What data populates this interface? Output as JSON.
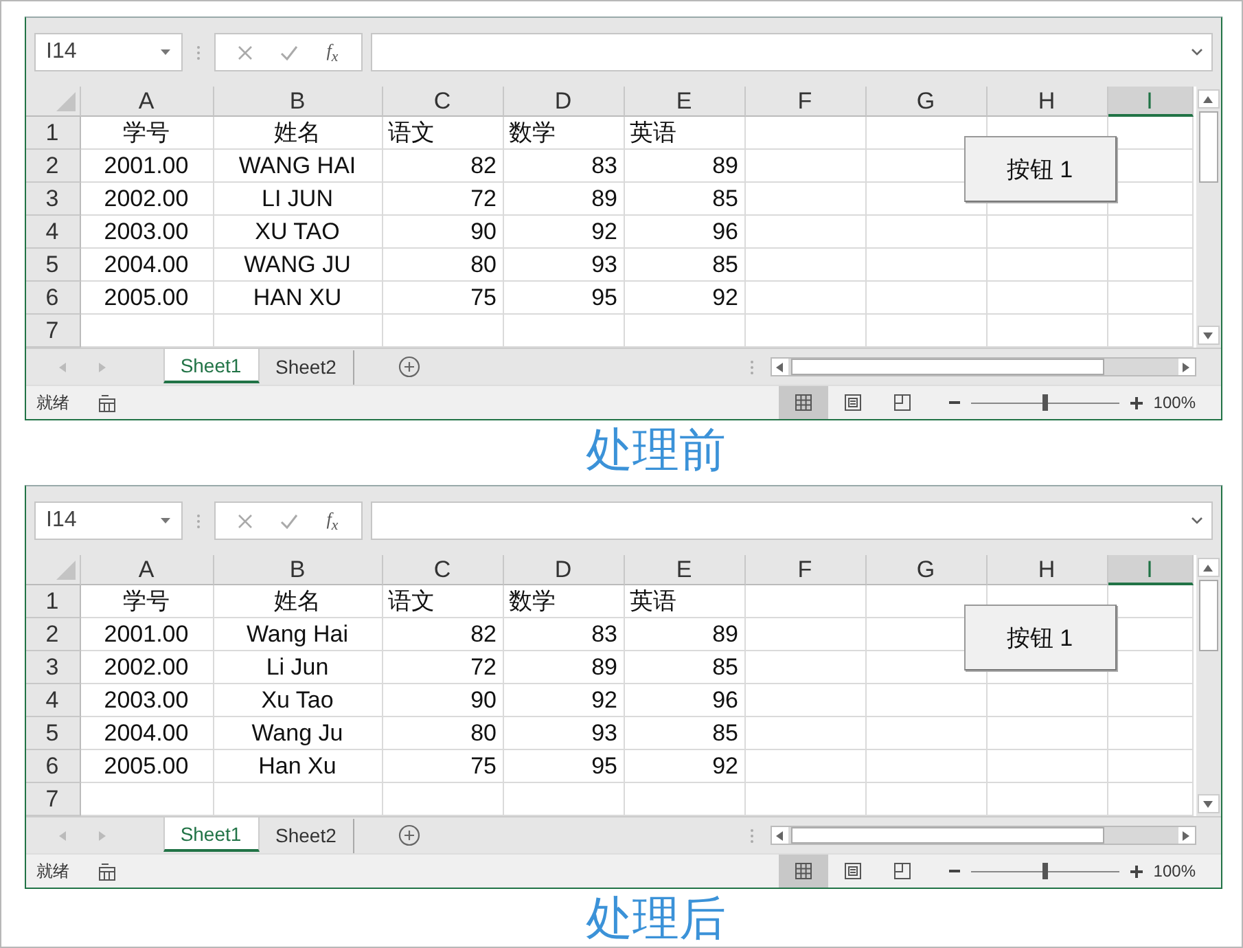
{
  "panels": [
    {
      "name_box": "I14",
      "fx_label": "f$_{x}$",
      "columns": [
        {
          "label": "A",
          "selected": false
        },
        {
          "label": "B",
          "selected": false
        },
        {
          "label": "C",
          "selected": false
        },
        {
          "label": "D",
          "selected": false
        },
        {
          "label": "E",
          "selected": false
        },
        {
          "label": "F",
          "selected": false
        },
        {
          "label": "G",
          "selected": false
        },
        {
          "label": "H",
          "selected": false
        },
        {
          "label": "I",
          "selected": true
        }
      ],
      "rows": [
        {
          "number": "1",
          "kind": "header",
          "cells": [
            "学号",
            "姓名",
            "语文",
            "数学",
            "英语"
          ]
        },
        {
          "number": "2",
          "kind": "record",
          "cells": [
            "2001.00",
            "WANG HAI",
            "82",
            "83",
            "89"
          ]
        },
        {
          "number": "3",
          "kind": "record",
          "cells": [
            "2002.00",
            "LI JUN",
            "72",
            "89",
            "85"
          ]
        },
        {
          "number": "4",
          "kind": "record",
          "cells": [
            "2003.00",
            "XU TAO",
            "90",
            "92",
            "96"
          ]
        },
        {
          "number": "5",
          "kind": "record",
          "cells": [
            "2004.00",
            "WANG JU",
            "80",
            "93",
            "85"
          ]
        },
        {
          "number": "6",
          "kind": "record",
          "cells": [
            "2005.00",
            "HAN XU",
            "75",
            "95",
            "92"
          ]
        },
        {
          "number": "7"
        }
      ],
      "button": "按钮 1",
      "sheets": [
        {
          "label": "Sheet1",
          "selected": true
        },
        {
          "label": "Sheet2",
          "selected": false
        }
      ],
      "status_text": "就绪",
      "views": [
        {
          "kind": "normal",
          "selected": true
        },
        {
          "kind": "page-layout",
          "selected": false
        },
        {
          "kind": "page-break",
          "selected": false
        }
      ],
      "zoom_slider": {
        "level": 0.5
      },
      "zoom": "100%",
      "caption": "处理前"
    },
    {
      "name_box": "I14",
      "fx_label": "f$_{x}$",
      "columns": [
        {
          "label": "A",
          "selected": false
        },
        {
          "label": "B",
          "selected": false
        },
        {
          "label": "C",
          "selected": false
        },
        {
          "label": "D",
          "selected": false
        },
        {
          "label": "E",
          "selected": false
        },
        {
          "label": "F",
          "selected": false
        },
        {
          "label": "G",
          "selected": false
        },
        {
          "label": "H",
          "selected": false
        },
        {
          "label": "I",
          "selected": true
        }
      ],
      "rows": [
        {
          "number": "1",
          "kind": "header",
          "cells": [
            "学号",
            "姓名",
            "语文",
            "数学",
            "英语"
          ]
        },
        {
          "number": "2",
          "kind": "record",
          "cells": [
            "2001.00",
            "Wang Hai",
            "82",
            "83",
            "89"
          ]
        },
        {
          "number": "3",
          "kind": "record",
          "cells": [
            "2002.00",
            "Li Jun",
            "72",
            "89",
            "85"
          ]
        },
        {
          "number": "4",
          "kind": "record",
          "cells": [
            "2003.00",
            "Xu Tao",
            "90",
            "92",
            "96"
          ]
        },
        {
          "number": "5",
          "kind": "record",
          "cells": [
            "2004.00",
            "Wang Ju",
            "80",
            "93",
            "85"
          ]
        },
        {
          "number": "6",
          "kind": "record",
          "cells": [
            "2005.00",
            "Han Xu",
            "75",
            "95",
            "92"
          ]
        },
        {
          "number": "7"
        }
      ],
      "button": "按钮 1",
      "sheets": [
        {
          "label": "Sheet1",
          "selected": true
        },
        {
          "label": "Sheet2",
          "selected": false
        }
      ],
      "status_text": "就绪",
      "views": [
        {
          "kind": "normal",
          "selected": true
        },
        {
          "kind": "page-layout",
          "selected": false
        },
        {
          "kind": "page-break",
          "selected": false
        }
      ],
      "zoom_slider": {
        "level": 0.5
      },
      "zoom": "100%",
      "caption": "处理后"
    }
  ]
}
